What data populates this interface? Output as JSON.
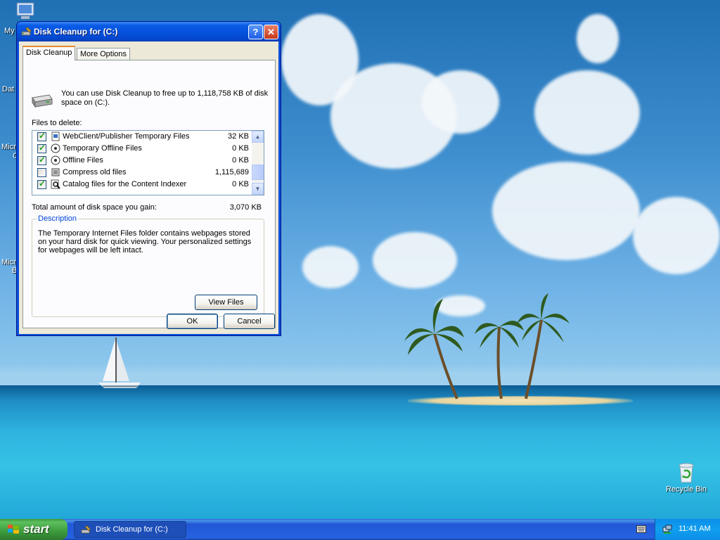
{
  "desktop": {
    "icons": [
      {
        "label": "My"
      },
      {
        "label": "Dat"
      },
      {
        "label": "Micr"
      },
      {
        "label": "C"
      },
      {
        "label": "Micr"
      },
      {
        "label": "B"
      },
      {
        "label": "Recycle Bin"
      }
    ]
  },
  "window": {
    "title": "Disk Cleanup for  (C:)",
    "help_label": "?",
    "close_label": "✕",
    "tabs": [
      {
        "label": "Disk Cleanup",
        "selected": true
      },
      {
        "label": "More Options",
        "selected": false
      }
    ],
    "intro": "You can use Disk Cleanup to free up to 1,118,758 KB of disk space on  (C:).",
    "files_label": "Files to delete:",
    "files": [
      {
        "name": "WebClient/Publisher Temporary Files",
        "size": "32 KB",
        "checked": true,
        "icon": "web-files-icon"
      },
      {
        "name": "Temporary Offline Files",
        "size": "0 KB",
        "checked": true,
        "icon": "offline-files-icon"
      },
      {
        "name": "Offline Files",
        "size": "0 KB",
        "checked": true,
        "icon": "offline-files-icon"
      },
      {
        "name": "Compress old files",
        "size": "1,115,689",
        "checked": false,
        "icon": "compress-icon"
      },
      {
        "name": "Catalog files for the Content Indexer",
        "size": "0 KB",
        "checked": true,
        "icon": "catalog-search-icon"
      }
    ],
    "total_label": "Total amount of disk space you gain:",
    "total_value": "3,070 KB",
    "description_legend": "Description",
    "description_text": "The Temporary Internet Files folder contains webpages stored on your hard disk for quick viewing. Your personalized settings for webpages will be left intact.",
    "view_files_label": "View Files",
    "ok_label": "OK",
    "cancel_label": "Cancel"
  },
  "taskbar": {
    "start_label": "start",
    "task_label": "Disk Cleanup for  (C:)",
    "clock": "11:41 AM"
  },
  "colors": {
    "titlebar": "#0553de",
    "start": "#3c9a3c",
    "taskbar": "#2157d7",
    "tray": "#0c8ee8"
  }
}
